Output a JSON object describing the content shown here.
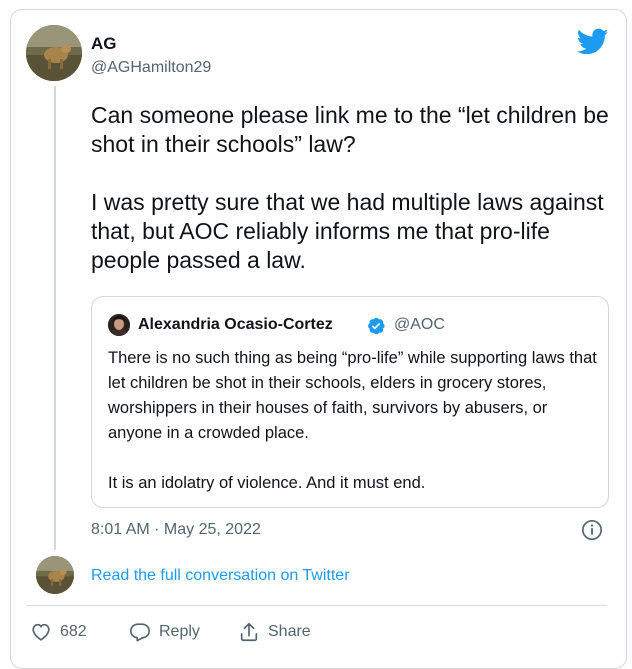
{
  "tweet": {
    "author_name": "AG",
    "author_handle": "@AGHamilton29",
    "text": "Can someone please link me to the “let children be shot in their schools” law?\n\nI was pretty sure that we had multiple laws against that, but AOC reliably informs me that pro-life people passed a law.",
    "timestamp": "8:01 AM · May 25, 2022",
    "brand_icon": "twitter-bird-icon",
    "brand_color": "#1d9bf0"
  },
  "quote": {
    "author_name": "Alexandria Ocasio-Cortez",
    "verified": true,
    "verified_icon": "verified-badge-icon",
    "author_handle": "@AOC",
    "text": "There is no such thing as being “pro-life” while supporting laws that let children be shot in their schools, elders in grocery stores, worshippers in their houses of faith, survivors by abusers, or anyone in a crowded place.\n\nIt is an idolatry of violence. And it must end."
  },
  "read_more": "Read the full conversation on Twitter",
  "actions": {
    "like_count": "682",
    "reply_label": "Reply",
    "share_label": "Share"
  },
  "colors": {
    "link": "#1d9bf0",
    "secondary_text": "#536471",
    "border": "#cfd9de"
  }
}
